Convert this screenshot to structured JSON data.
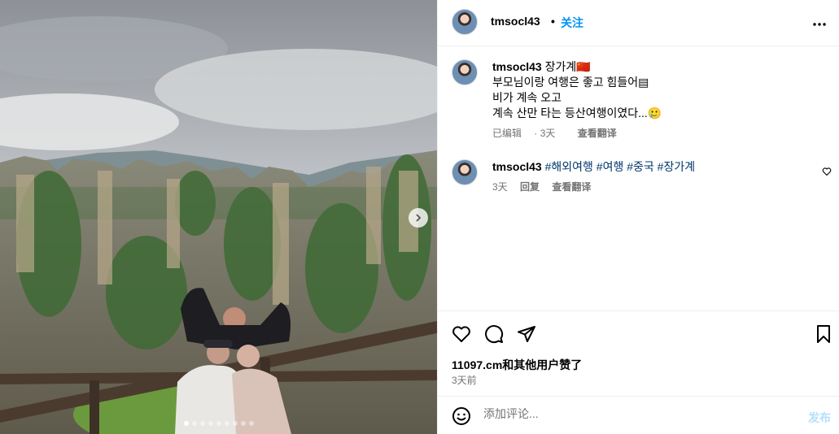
{
  "post": {
    "username": "tmsocl43",
    "separator": "•",
    "follow_label": "关注",
    "more_icon": "more-horizontal-icon"
  },
  "caption": {
    "username": "tmsocl43",
    "lines": [
      "장가계🇨🇳",
      "부모님이랑 여행은 좋고 힘들어▤",
      "비가 계속 오고",
      "계속 산만 타는 등산여행이였다...🥲"
    ],
    "edited": "已编辑",
    "time": "3天",
    "translate": "查看翻译"
  },
  "comments": [
    {
      "username": "tmsocl43",
      "text": "#해외여행 #여행 #중국 #장가계",
      "time": "3天",
      "reply": "回复",
      "translate": "查看翻译"
    }
  ],
  "actions": {
    "like_icon": "heart-icon",
    "comment_icon": "comment-icon",
    "share_icon": "paper-plane-icon",
    "save_icon": "bookmark-icon",
    "likes_text": "11097.cm和其他用户赞了",
    "date": "3天前"
  },
  "add_comment": {
    "placeholder": "添加评论...",
    "post_label": "发布"
  },
  "carousel": {
    "count": 9,
    "active_index": 0
  }
}
